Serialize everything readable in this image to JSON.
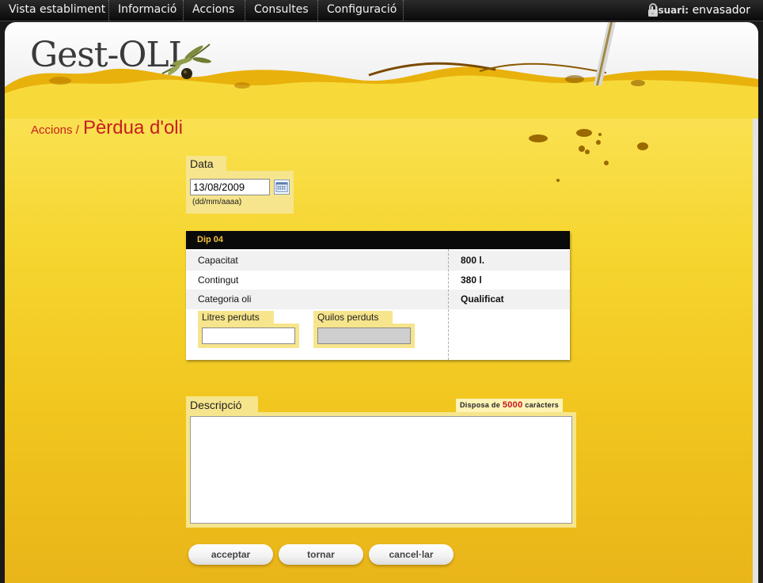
{
  "nav": {
    "items": [
      "Vista establiment",
      "Informació",
      "Accions",
      "Consultes",
      "Configuració"
    ],
    "user_label": "Usuari:",
    "user_name": "envasador"
  },
  "logo": {
    "text": "Gest-OLI"
  },
  "breadcrumb": {
    "parent": "Accions /",
    "current": "Pèrdua d'oli"
  },
  "date_field": {
    "label": "Data",
    "value": "13/08/2009",
    "format_hint": "(dd/mm/aaaa)"
  },
  "tank": {
    "name": "Dip 04",
    "rows": [
      {
        "label": "Capacitat",
        "value": "800 l."
      },
      {
        "label": "Contingut",
        "value": "380 l"
      },
      {
        "label": "Categoria oli",
        "value": "Qualificat"
      }
    ],
    "liters_lost_label": "Litres perduts",
    "liters_lost_value": "",
    "kilos_lost_label": "Quilos perduts",
    "kilos_lost_value": ""
  },
  "description": {
    "label": "Descripció",
    "chars_prefix": "Disposa de",
    "chars_count": "5000",
    "chars_suffix": "caràcters",
    "value": ""
  },
  "buttons": {
    "accept": "acceptar",
    "back": "tornar",
    "cancel": "cancel·lar"
  },
  "colors": {
    "accent_red": "#c51f1f",
    "oil_yellow": "#f6d631",
    "label_bg": "#f6e58c",
    "header_gold": "#f6c23a"
  },
  "icons": [
    "lock-icon",
    "calendar-icon",
    "olive-branch-icon"
  ]
}
